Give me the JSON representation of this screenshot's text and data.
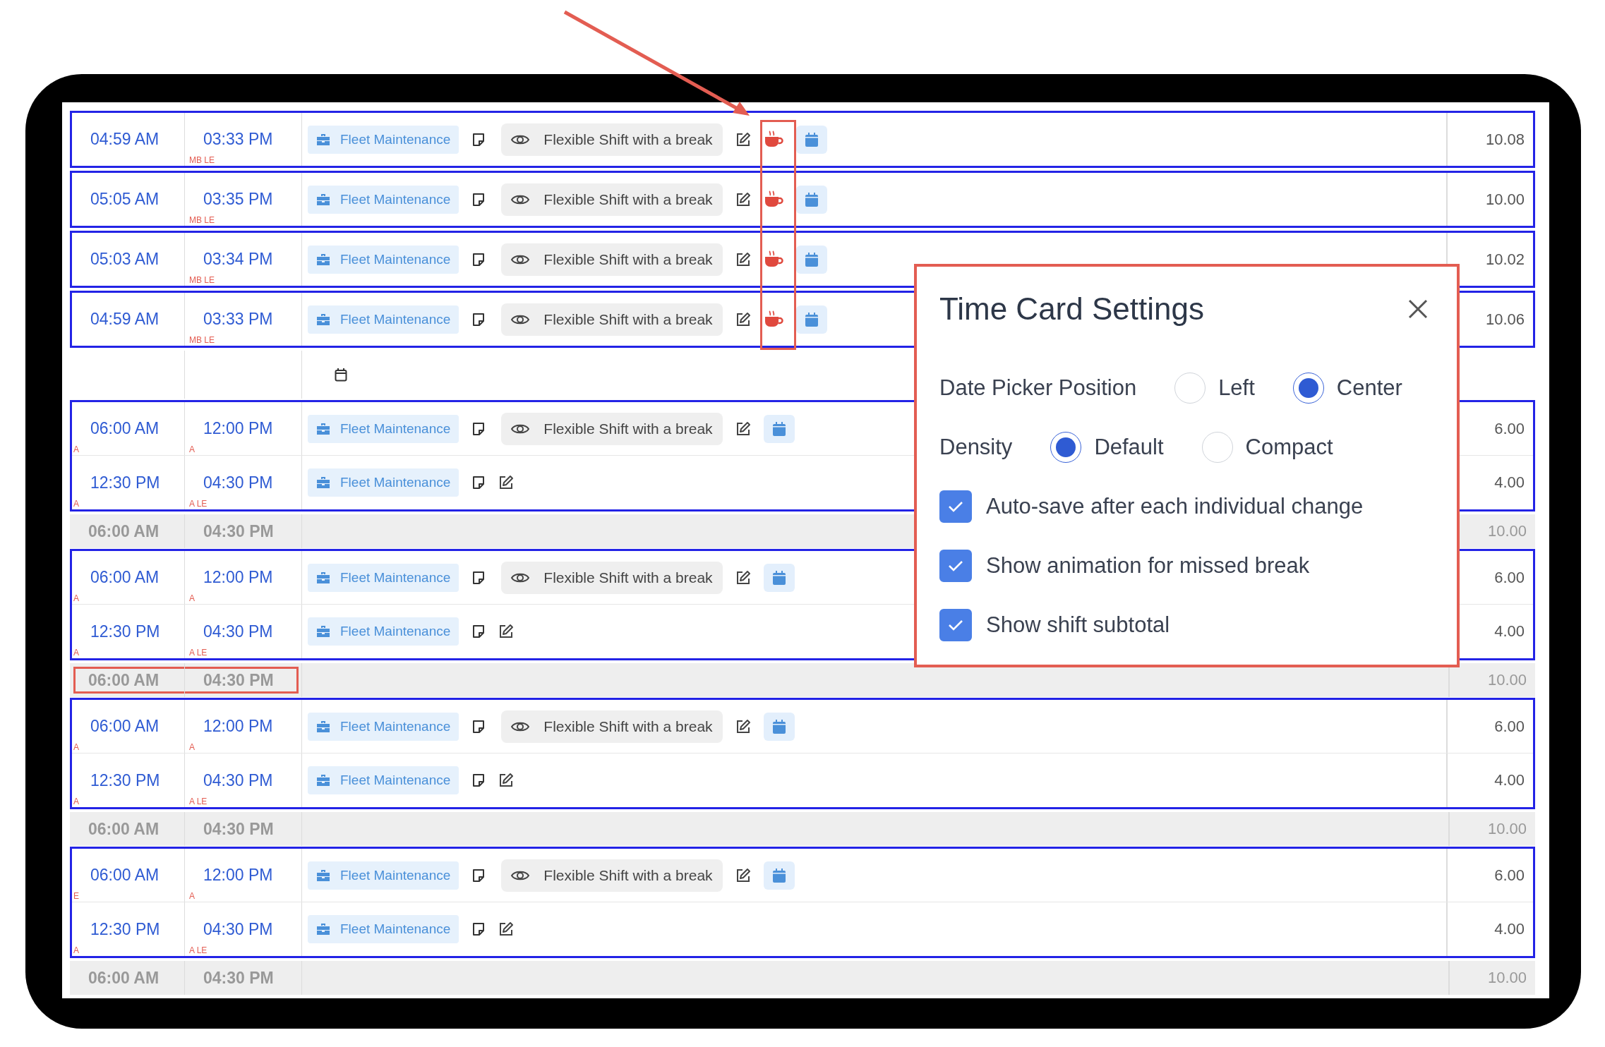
{
  "annotations": {
    "arrow": true,
    "column_highlight": true
  },
  "sections": [
    {
      "kind": "group",
      "entries": [
        {
          "start": "04:59 AM",
          "end": "03:33 PM",
          "end_flag": "MB LE",
          "job": "Fleet Maintenance",
          "shift": "Flexible Shift with a break",
          "missed_break": true,
          "calendar": true,
          "hours": "10.08"
        }
      ]
    },
    {
      "kind": "group",
      "entries": [
        {
          "start": "05:05 AM",
          "end": "03:35 PM",
          "end_flag": "MB LE",
          "job": "Fleet Maintenance",
          "shift": "Flexible Shift with a break",
          "missed_break": true,
          "calendar": true,
          "hours": "10.00"
        }
      ]
    },
    {
      "kind": "group",
      "entries": [
        {
          "start": "05:03 AM",
          "end": "03:34 PM",
          "end_flag": "MB LE",
          "job": "Fleet Maintenance",
          "shift": "Flexible Shift with a break",
          "missed_break": true,
          "calendar": true,
          "hours": "10.02"
        }
      ]
    },
    {
      "kind": "group",
      "entries": [
        {
          "start": "04:59 AM",
          "end": "03:33 PM",
          "end_flag": "MB LE",
          "job": "Fleet Maintenance",
          "shift": "Flexible Shift with a break",
          "missed_break": true,
          "calendar": true,
          "hours": "10.06"
        }
      ]
    },
    {
      "kind": "blank"
    },
    {
      "kind": "group",
      "entries": [
        {
          "start": "06:00 AM",
          "start_flag": "A",
          "end": "12:00 PM",
          "end_flag": "A",
          "job": "Fleet Maintenance",
          "shift": "Flexible Shift with a break",
          "missed_break": false,
          "calendar": true,
          "hours": "6.00"
        },
        {
          "start": "12:30 PM",
          "start_flag": "A",
          "end": "04:30 PM",
          "end_flag": "A LE",
          "job": "Fleet Maintenance",
          "missed_break": false,
          "calendar": false,
          "hours": "4.00"
        }
      ]
    },
    {
      "kind": "subtotal",
      "start": "06:00 AM",
      "end": "04:30 PM",
      "total": "10.00",
      "highlighted": false
    },
    {
      "kind": "group",
      "entries": [
        {
          "start": "06:00 AM",
          "start_flag": "A",
          "end": "12:00 PM",
          "end_flag": "A",
          "job": "Fleet Maintenance",
          "shift": "Flexible Shift with a break",
          "missed_break": false,
          "calendar": true,
          "hours": "6.00"
        },
        {
          "start": "12:30 PM",
          "start_flag": "A",
          "end": "04:30 PM",
          "end_flag": "A LE",
          "job": "Fleet Maintenance",
          "missed_break": false,
          "calendar": false,
          "hours": "4.00"
        }
      ]
    },
    {
      "kind": "subtotal",
      "start": "06:00 AM",
      "end": "04:30 PM",
      "total": "10.00",
      "highlighted": true
    },
    {
      "kind": "group",
      "entries": [
        {
          "start": "06:00 AM",
          "start_flag": "A",
          "end": "12:00 PM",
          "end_flag": "A",
          "job": "Fleet Maintenance",
          "shift": "Flexible Shift with a break",
          "missed_break": false,
          "calendar": true,
          "hours": "6.00"
        },
        {
          "start": "12:30 PM",
          "start_flag": "A",
          "end": "04:30 PM",
          "end_flag": "A LE",
          "job": "Fleet Maintenance",
          "missed_break": false,
          "calendar": false,
          "hours": "4.00"
        }
      ]
    },
    {
      "kind": "subtotal",
      "start": "06:00 AM",
      "end": "04:30 PM",
      "total": "10.00",
      "highlighted": false
    },
    {
      "kind": "group",
      "entries": [
        {
          "start": "06:00 AM",
          "start_flag": "E",
          "end": "12:00 PM",
          "end_flag": "A",
          "job": "Fleet Maintenance",
          "shift": "Flexible Shift with a break",
          "missed_break": false,
          "calendar": true,
          "hours": "6.00"
        },
        {
          "start": "12:30 PM",
          "start_flag": "A",
          "end": "04:30 PM",
          "end_flag": "A LE",
          "job": "Fleet Maintenance",
          "missed_break": false,
          "calendar": false,
          "hours": "4.00"
        }
      ]
    },
    {
      "kind": "subtotal",
      "start": "06:00 AM",
      "end": "04:30 PM",
      "total": "10.00",
      "highlighted": false
    }
  ],
  "settings_dialog": {
    "title": "Time Card Settings",
    "options": [
      {
        "kind": "radio",
        "label": "Date Picker Position",
        "choices": [
          {
            "label": "Left",
            "selected": false
          },
          {
            "label": "Center",
            "selected": true
          }
        ]
      },
      {
        "kind": "radio",
        "label": "Density",
        "choices": [
          {
            "label": "Default",
            "selected": true
          },
          {
            "label": "Compact",
            "selected": false
          }
        ]
      },
      {
        "kind": "checkbox",
        "label": "Auto-save after each individual change",
        "checked": true
      },
      {
        "kind": "checkbox",
        "label": "Show animation for missed break",
        "checked": true
      },
      {
        "kind": "checkbox",
        "label": "Show shift subtotal",
        "checked": true
      }
    ]
  }
}
